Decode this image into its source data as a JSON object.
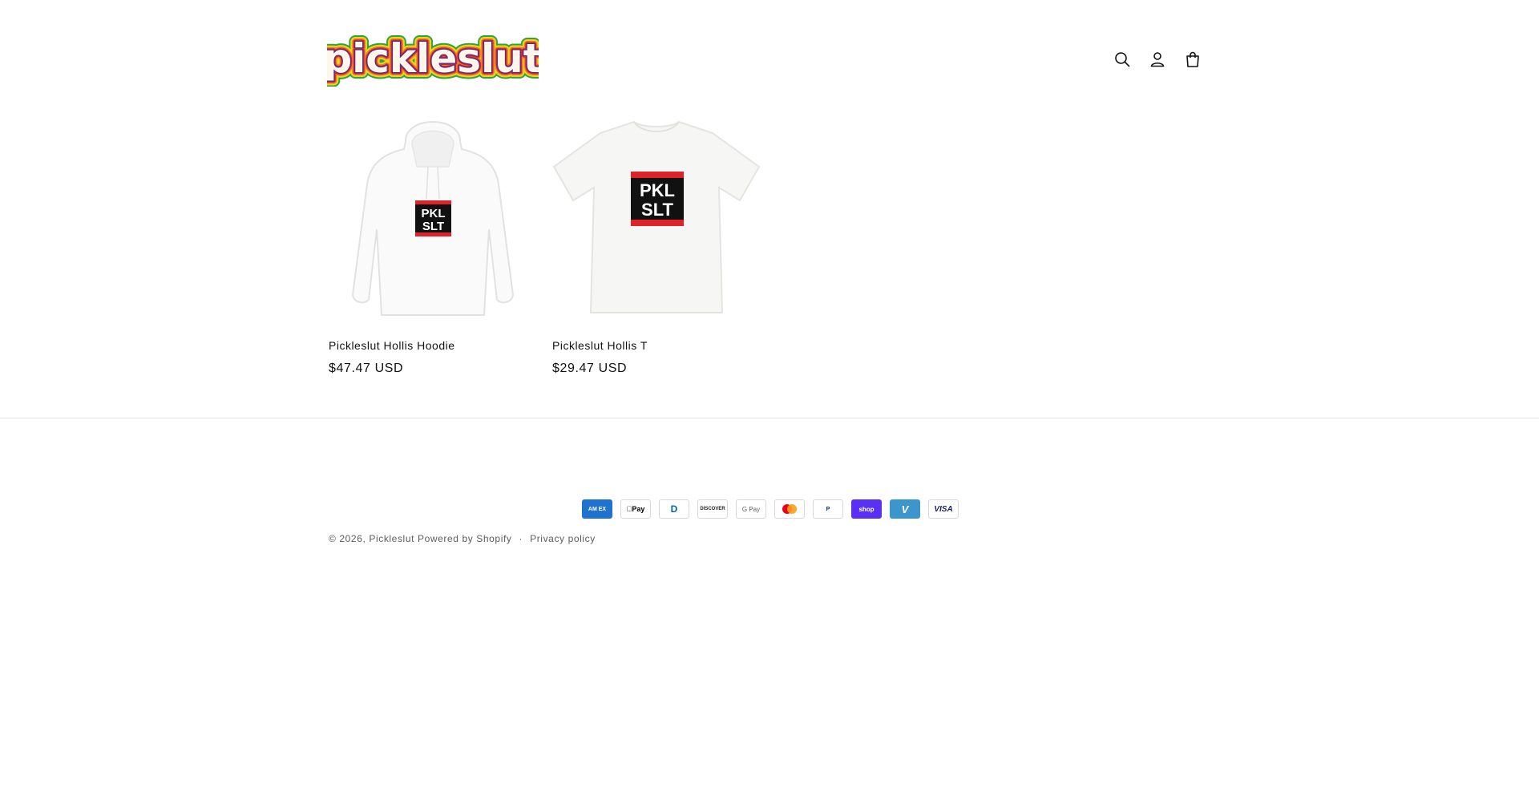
{
  "header": {
    "logo_text": "pickleslut",
    "icons": [
      "search-icon",
      "account-icon",
      "cart-icon"
    ]
  },
  "products": [
    {
      "title": "Pickleslut Hollis Hoodie",
      "price": "$47.47 USD",
      "print_line1": "PKL",
      "print_line2": "SLT"
    },
    {
      "title": "Pickleslut Hollis T",
      "price": "$29.47 USD",
      "print_line1": "PKL",
      "print_line2": "SLT"
    }
  ],
  "payments": [
    {
      "name": "American Express",
      "label": "AM EX"
    },
    {
      "name": "Apple Pay",
      "label": "Pay"
    },
    {
      "name": "Diners Club",
      "label": "D"
    },
    {
      "name": "Discover",
      "label": "DISCOVER"
    },
    {
      "name": "Google Pay",
      "label": "G Pay"
    },
    {
      "name": "Mastercard",
      "label": ""
    },
    {
      "name": "PayPal",
      "label": "P"
    },
    {
      "name": "Shop Pay",
      "label": "shop"
    },
    {
      "name": "Venmo",
      "label": "V"
    },
    {
      "name": "Visa",
      "label": "VISA"
    }
  ],
  "footer": {
    "copyright_prefix": "© 2026,",
    "store_link": "Pickleslut",
    "powered_by": "Powered by Shopify",
    "separator": "·",
    "privacy_link": "Privacy policy"
  },
  "colors": {
    "text": "#121212",
    "muted": "#5c5c5c",
    "divider": "#e6e6e6",
    "print_red": "#e0232b"
  }
}
